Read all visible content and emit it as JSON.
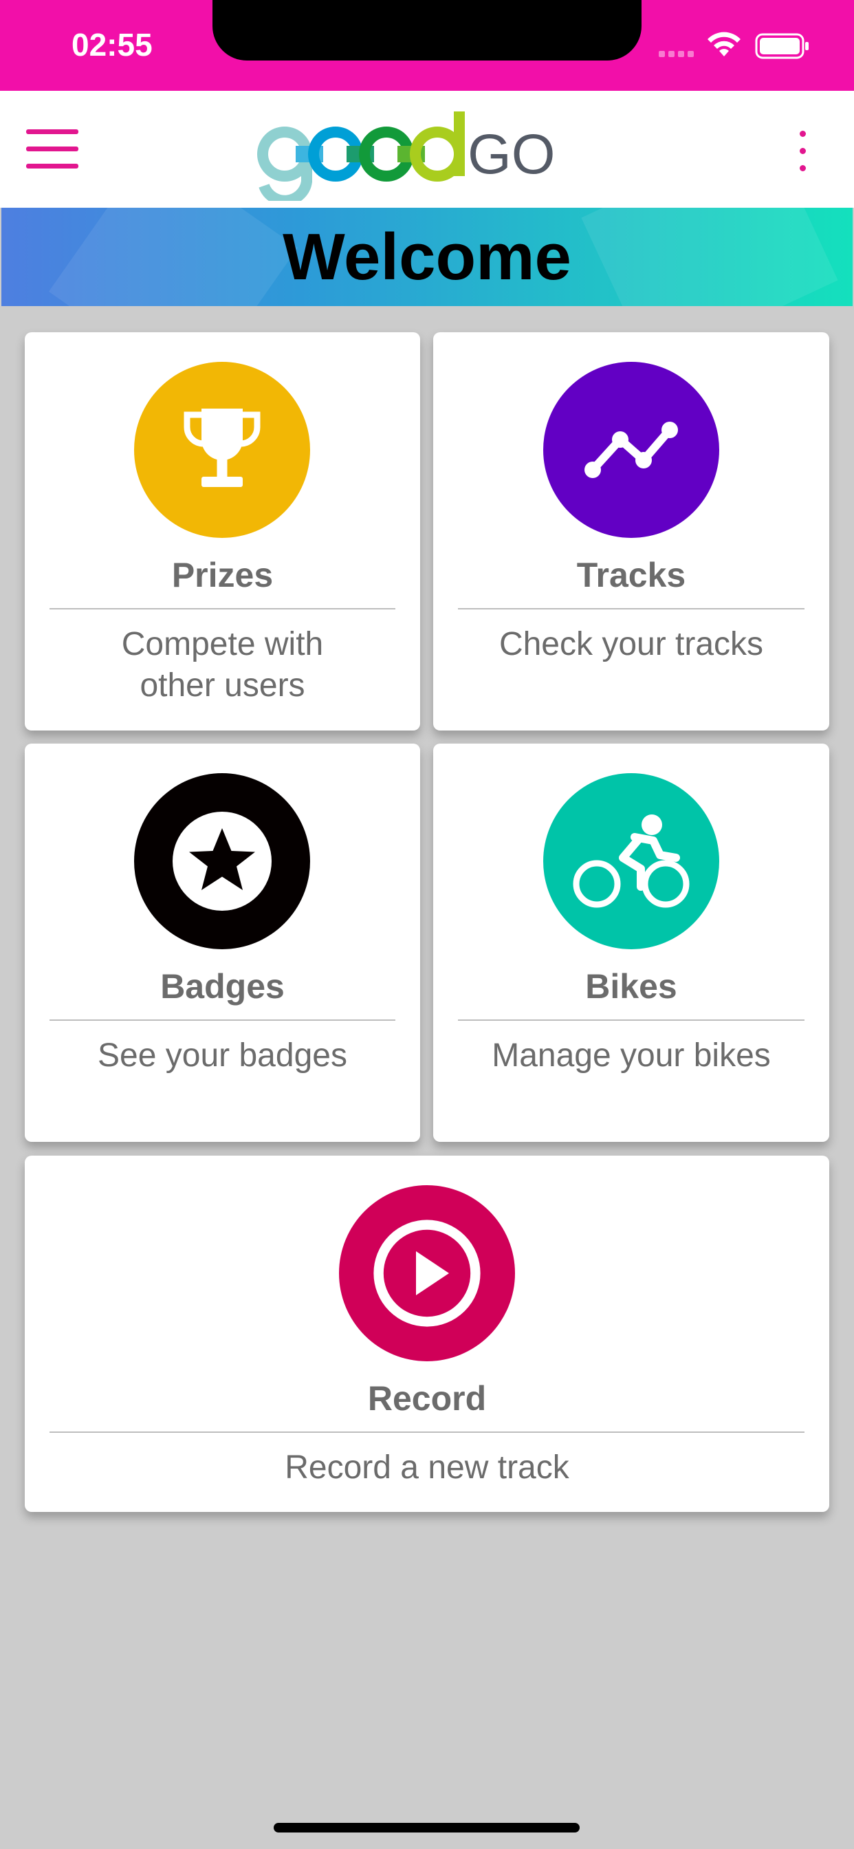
{
  "status_bar": {
    "time": "02:55"
  },
  "header": {
    "logo_text": "goodGO"
  },
  "banner": {
    "title": "Welcome"
  },
  "cards": [
    {
      "title": "Prizes",
      "description": "Compete with other users",
      "icon": "trophy-icon",
      "color": "#f2b705"
    },
    {
      "title": "Tracks",
      "description": "Check your tracks",
      "icon": "track-line-icon",
      "color": "#6200c4"
    },
    {
      "title": "Badges",
      "description": "See your badges",
      "icon": "star-badge-icon",
      "color": "#050000"
    },
    {
      "title": "Bikes",
      "description": "Manage your bikes",
      "icon": "cyclist-icon",
      "color": "#00c4a8"
    },
    {
      "title": "Record",
      "description": "Record a new track",
      "icon": "play-icon",
      "color": "#d00058"
    }
  ],
  "colors": {
    "status_bar": "#f20fa9",
    "accent": "#e2168f",
    "background": "#cccccc"
  }
}
